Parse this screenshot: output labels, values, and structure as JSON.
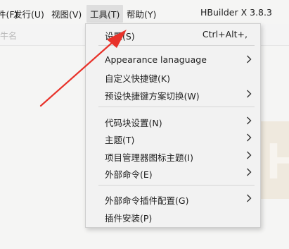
{
  "menubar": {
    "items": [
      {
        "label": "件(F)"
      },
      {
        "label": "发行(U)"
      },
      {
        "label": "视图(V)"
      },
      {
        "label": "工具(T)"
      },
      {
        "label": "帮助(Y)"
      }
    ],
    "app_title": "HBuilder X 3.8.3"
  },
  "subbar": {
    "text": "牛名"
  },
  "tools_menu": {
    "items": [
      {
        "label": "设置(S)",
        "shortcut": "Ctrl+Alt+,"
      },
      {
        "label": "Appearance lanaguage"
      },
      {
        "label": "自定义快捷键(K)"
      },
      {
        "label": "预设快捷键方案切换(W)"
      },
      {
        "label": "代码块设置(N)"
      },
      {
        "label": "主题(T)"
      },
      {
        "label": "项目管理器图标主题(I)"
      },
      {
        "label": "外部命令(E)"
      },
      {
        "label": "外部命令插件配置(G)"
      },
      {
        "label": "插件安装(P)"
      }
    ]
  },
  "colors": {
    "annotation_arrow": "#e8322a",
    "active_menu_bg": "#dedede"
  },
  "icons": {
    "submenu": "chevron-right-icon",
    "annotation": "red-arrow-annotation"
  }
}
